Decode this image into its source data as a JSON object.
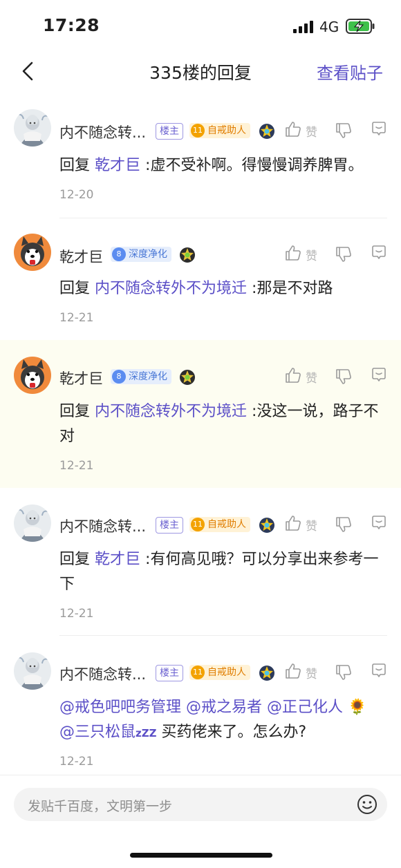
{
  "status": {
    "time": "17:28",
    "network": "4G"
  },
  "nav": {
    "title": "335楼的回复",
    "link": "查看贴子"
  },
  "labels": {
    "like": "赞",
    "reply_prefix": "回复",
    "host_badge": "楼主"
  },
  "replies": [
    {
      "user": "内不随念转...",
      "level": "11",
      "title": "自戒助人",
      "is_host": true,
      "mention": "乾才巨",
      "text": ":虚不受补啊。得慢慢调养脾胃。",
      "date": "12-20"
    },
    {
      "user": "乾才巨",
      "level": "8",
      "title": "深度净化",
      "is_host": false,
      "mention": "内不随念转外不为境迁",
      "text": ":那是不对路",
      "date": "12-21"
    },
    {
      "user": "乾才巨",
      "level": "8",
      "title": "深度净化",
      "is_host": false,
      "mention": "内不随念转外不为境迁",
      "text": ":没这一说，路子不对",
      "date": "12-21"
    },
    {
      "user": "内不随念转...",
      "level": "11",
      "title": "自戒助人",
      "is_host": true,
      "mention": "乾才巨",
      "text": ":有何高见哦？可以分享出来参考一下",
      "date": "12-21"
    },
    {
      "user": "内不随念转...",
      "level": "11",
      "title": "自戒助人",
      "is_host": true,
      "mentions": [
        "@戒色吧吧务管理",
        "@戒之易者",
        "@正己化人",
        "@三只松鼠"
      ],
      "emoji_sunflower": "🌻",
      "sleep_mark": "zZZ",
      "text": "买药佬来了。怎么办?",
      "date": "12-21"
    }
  ],
  "input": {
    "placeholder": "发贴千百度，文明第一步"
  },
  "colors": {
    "accent": "#5b4fc7",
    "highlight_bg": "#fdfdf1",
    "level_gold": "#f3a200",
    "level_blue": "#5b8cf0"
  }
}
